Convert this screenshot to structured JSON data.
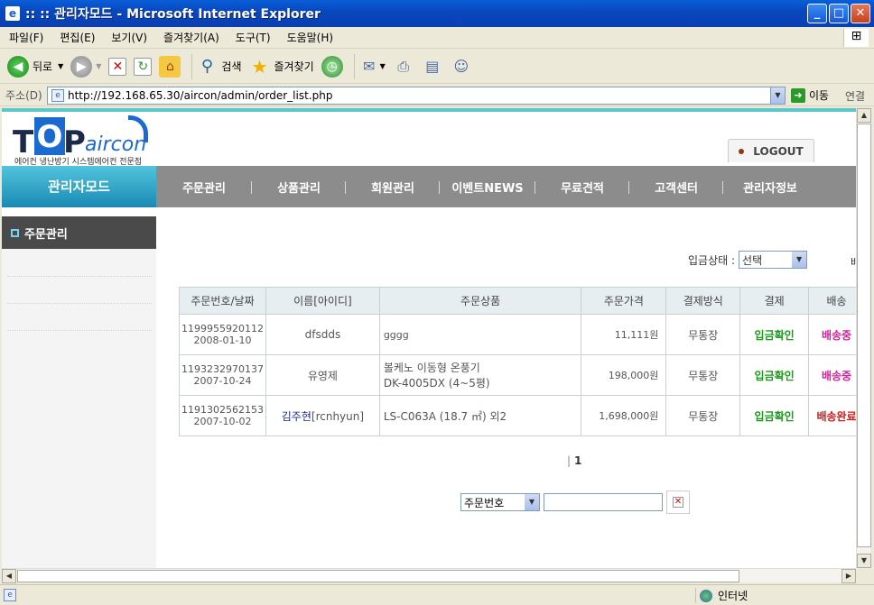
{
  "window": {
    "title": ":: :: 관리자모드 - Microsoft Internet Explorer",
    "minimize": "_",
    "maximize": "□",
    "close": "✕"
  },
  "menubar": {
    "items": [
      "파일(F)",
      "편집(E)",
      "보기(V)",
      "즐겨찾기(A)",
      "도구(T)",
      "도움말(H)"
    ]
  },
  "toolbar": {
    "back": "뒤로",
    "search": "검색",
    "favorites": "즐겨찾기"
  },
  "addressbar": {
    "label": "주소(D)",
    "url": "http://192.168.65.30/aircon/admin/order_list.php",
    "go": "이동",
    "links": "연결"
  },
  "site": {
    "logo_text": "aircon",
    "logo_sub": "에어컨 냉난방기 시스템에어컨 전문점",
    "logout": "LOGOUT",
    "admin_mode": "관리자모드",
    "nav": [
      "주문관리",
      "상품관리",
      "회원관리",
      "이벤트NEWS",
      "무료견적",
      "고객센터",
      "관리자정보"
    ],
    "sidebar_title": "주문관리"
  },
  "filter": {
    "label": "입금상태 :",
    "selected": "선택",
    "cutoff_text": "배"
  },
  "orders": {
    "columns": [
      "주문번호/날짜",
      "이름[아이디]",
      "주문상품",
      "주문가격",
      "결제방식",
      "결제",
      "배송"
    ],
    "rows": [
      {
        "order_no": "1199955920112",
        "date": "2008-01-10",
        "name": "dfsdds",
        "product_line1": "gggg",
        "product_line2": "",
        "price": "11,111원",
        "method": "무통장",
        "payment": "입금확인",
        "delivery": "배송중"
      },
      {
        "order_no": "1193232970137",
        "date": "2007-10-24",
        "name": "유영제",
        "product_line1": "볼케노 이동형 온풍기",
        "product_line2": "DK-4005DX (4~5평)",
        "price": "198,000원",
        "method": "무통장",
        "payment": "입금확인",
        "delivery": "배송중"
      },
      {
        "order_no": "1191302562153",
        "date": "2007-10-02",
        "name": "김주현",
        "name_id": "[rcnhyun]",
        "product_line1": "LS-C063A (18.7 ㎡) 외2",
        "product_line2": "",
        "price": "1,698,000원",
        "method": "무통장",
        "payment": "입금확인",
        "delivery": "배송완료"
      }
    ]
  },
  "pager": {
    "current": "1"
  },
  "search": {
    "field": "주문번호",
    "value": ""
  },
  "status": {
    "zone": "인터넷"
  }
}
